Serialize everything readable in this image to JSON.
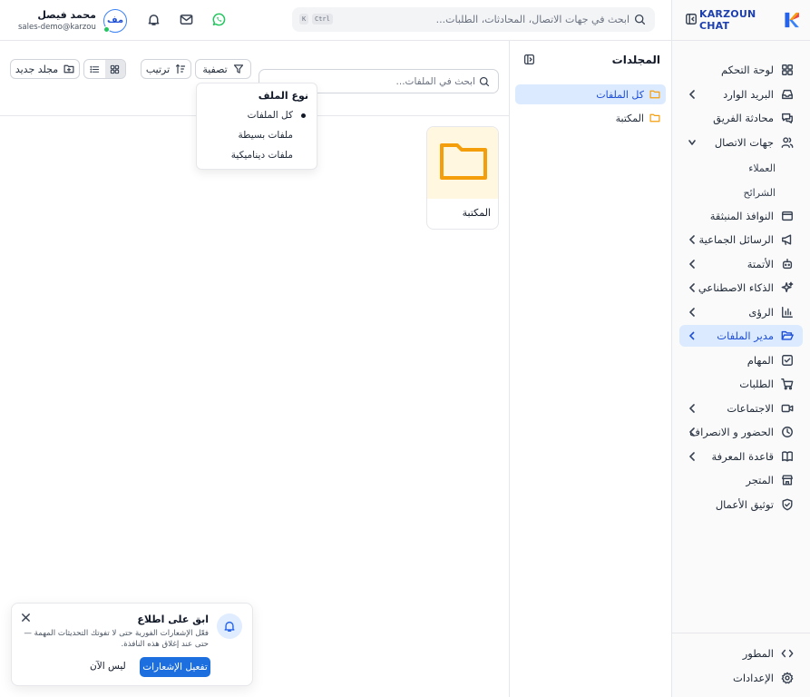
{
  "brand": {
    "name": "KARZOUN CHAT"
  },
  "search": {
    "placeholder": "ابحث في جهات الاتصال، المحادثات، الطلبات...",
    "shortcut_ctrl": "Ctrl",
    "shortcut_key": "K"
  },
  "user": {
    "initials": "مف",
    "name": "محمد فيصل",
    "email": "sales-demo@karzoun..."
  },
  "sidebar": {
    "items": [
      {
        "label": "لوحة التحكم",
        "icon": "dashboard-icon"
      },
      {
        "label": "البريد الوارد",
        "icon": "inbox-icon"
      },
      {
        "label": "محادثة الفريق",
        "icon": "team-chat-icon"
      },
      {
        "label": "جهات الاتصال",
        "icon": "contacts-icon"
      },
      {
        "label": "النوافذ المنبثقة",
        "icon": "popup-icon"
      },
      {
        "label": "الرسائل الجماعية",
        "icon": "megaphone-icon"
      },
      {
        "label": "الأتمتة",
        "icon": "bot-icon"
      },
      {
        "label": "الذكاء الاصطناعي",
        "icon": "sparkles-icon"
      },
      {
        "label": "الرؤى",
        "icon": "insights-icon"
      },
      {
        "label": "مدير الملفات",
        "icon": "folder-open-icon"
      },
      {
        "label": "المهام",
        "icon": "tasks-icon"
      },
      {
        "label": "الطلبات",
        "icon": "cart-icon"
      },
      {
        "label": "الاجتماعات",
        "icon": "video-icon"
      },
      {
        "label": "الحضور و الانصراف",
        "icon": "clock-icon"
      },
      {
        "label": "قاعدة المعرفة",
        "icon": "book-icon"
      },
      {
        "label": "المتجر",
        "icon": "store-icon"
      },
      {
        "label": "توثيق الأعمال",
        "icon": "shield-check-icon"
      }
    ],
    "contacts_sub": [
      "العملاء",
      "الشرائح"
    ],
    "developer_label": "المطور",
    "settings_label": "الإعدادات"
  },
  "folders": {
    "title": "المجلدات",
    "items": [
      {
        "label": "كل الملفات",
        "selected": true
      },
      {
        "label": "المكتبة",
        "selected": false
      }
    ]
  },
  "toolbar": {
    "search_placeholder": "ابحث في الملفات...",
    "filter_label": "تصفية",
    "sort_label": "ترتيب",
    "new_folder_label": "مجلد جديد"
  },
  "filter_menu": {
    "heading": "نوع الملف",
    "options": [
      "كل الملفات",
      "ملفات بسيطة",
      "ملفات ديناميكية"
    ],
    "selected": "كل الملفات"
  },
  "files": [
    {
      "name": "المكتبة",
      "type": "folder"
    }
  ],
  "toast": {
    "title": "ابق على اطلاع",
    "body": "فعّل الإشعارات الفورية حتى لا تفوتك التحديثات المهمة — حتى عند إغلاق هذه النافذة.",
    "enable_label": "تفعيل الإشعارات",
    "later_label": "ليس الآن"
  },
  "colors": {
    "accent": "#1d6fe0",
    "active_bg": "#dbeafe",
    "folder": "#f59e0b",
    "whatsapp": "#22c55e"
  }
}
